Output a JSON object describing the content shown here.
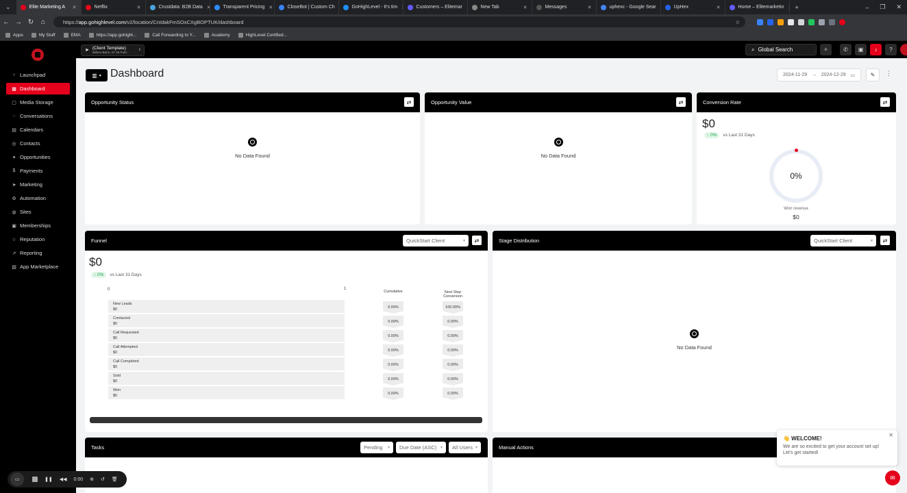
{
  "browser": {
    "tabs": [
      {
        "label": "Elite Marketing A",
        "color": "#e5001b",
        "active": true
      },
      {
        "label": "Netflix",
        "color": "#e50914"
      },
      {
        "label": "Crustdata: B2B Data",
        "color": "#4aa3df"
      },
      {
        "label": "Transparent Pricing",
        "color": "#2d8cff"
      },
      {
        "label": "CloseBot | Custom Ch",
        "color": "#3b82f6"
      },
      {
        "label": "GoHighLevel - It's tim",
        "color": "#1e90ff"
      },
      {
        "label": "Customers – Elitemar",
        "color": "#635bff"
      },
      {
        "label": "New Tab",
        "color": "#888888"
      },
      {
        "label": "Messages",
        "color": "#555555"
      },
      {
        "label": "uphexc - Google Sear",
        "color": "#4285f4"
      },
      {
        "label": "UpHex",
        "color": "#2563eb"
      },
      {
        "label": "Home – Elitemarketin",
        "color": "#635bff"
      }
    ],
    "url_prefix": "https://",
    "url_host": "app.gohighlevel.com",
    "url_path": "/v2/location/CnIdakFmSOxCXgBOPTUK/dashboard",
    "bookmarks": [
      "Apps",
      "My Stuff",
      "EMA",
      "https://app.gohighl...",
      "Call Forwarding to Y...",
      "Academy",
      "HighLevel Certified..."
    ]
  },
  "header": {
    "location_name": "(Client Template)",
    "location_address": "Wilkes-Barre, 67 69 Publ...",
    "search_label": "Global Search"
  },
  "sidebar": {
    "items": [
      {
        "label": "Launchpad",
        "icon": "○"
      },
      {
        "label": "Dashboard",
        "icon": "▦",
        "active": true
      },
      {
        "label": "Media Storage",
        "icon": "▢"
      },
      {
        "label": "Conversations",
        "icon": "◌"
      },
      {
        "label": "Calendars",
        "icon": "▤"
      },
      {
        "label": "Contacts",
        "icon": "◎"
      },
      {
        "label": "Opportunities",
        "icon": "✦"
      },
      {
        "label": "Payments",
        "icon": "$"
      },
      {
        "label": "Marketing",
        "icon": "➤"
      },
      {
        "label": "Automation",
        "icon": "⚙"
      },
      {
        "label": "Sites",
        "icon": "◍"
      },
      {
        "label": "Memberships",
        "icon": "▣"
      },
      {
        "label": "Reputation",
        "icon": "☆"
      },
      {
        "label": "Reporting",
        "icon": "↗"
      },
      {
        "label": "App Marketplace",
        "icon": "▧"
      }
    ]
  },
  "dashboard": {
    "title": "Dashboard",
    "date_start": "2024-11-29",
    "date_arrow": "→",
    "date_end": "2024-12-29",
    "no_data": "No Data Found",
    "opportunity_status": {
      "title": "Opportunity Status"
    },
    "opportunity_value": {
      "title": "Opportunity Value"
    },
    "conversion_rate": {
      "title": "Conversion Rate",
      "value": "$0",
      "change": "↑ 0%",
      "compare": "vs Last 31 Days",
      "percent": "0%",
      "won_label": "Won revenue",
      "won_value": "$0"
    },
    "funnel": {
      "title": "Funnel",
      "pipeline": "QuickStart Client",
      "value": "$0",
      "change": "↑ 0%",
      "compare": "vs Last 31 Days",
      "axis_min": "0",
      "axis_max": "1",
      "col_cumulative": "Cumulative",
      "col_next_1": "Next Step",
      "col_next_2": "Conversion",
      "stages": [
        {
          "name": "New Leads",
          "value": "$0",
          "cumulative": "0.00%",
          "next": "100.00%"
        },
        {
          "name": "Contacted",
          "value": "$0",
          "cumulative": "0.00%",
          "next": "0.00%"
        },
        {
          "name": "Call Requested",
          "value": "$0",
          "cumulative": "0.00%",
          "next": "0.00%"
        },
        {
          "name": "Call Attempted",
          "value": "$0",
          "cumulative": "0.00%",
          "next": "0.00%"
        },
        {
          "name": "Call Completed",
          "value": "$0",
          "cumulative": "0.00%",
          "next": "0.00%"
        },
        {
          "name": "Sold",
          "value": "$0",
          "cumulative": "0.00%",
          "next": "0.00%"
        },
        {
          "name": "Won",
          "value": "$0",
          "cumulative": "0.00%",
          "next": "0.00%"
        }
      ]
    },
    "stage_distribution": {
      "title": "Stage Distribution",
      "pipeline": "QuickStart Client"
    },
    "tasks": {
      "title": "Tasks",
      "filter_status": "Pending",
      "filter_sort": "Due Date (ASC)",
      "filter_users": "All Users"
    },
    "manual_actions": {
      "title": "Manual Actions"
    }
  },
  "toast": {
    "title": "👋 WELCOME!",
    "body_1": "We are so excited to get your account set up!",
    "body_2": "Let's get started!"
  },
  "recorder": {
    "time": "0:00"
  },
  "colors": {
    "accent": "#e5001b",
    "header": "#000000",
    "canvas": "#f2f3f5"
  }
}
